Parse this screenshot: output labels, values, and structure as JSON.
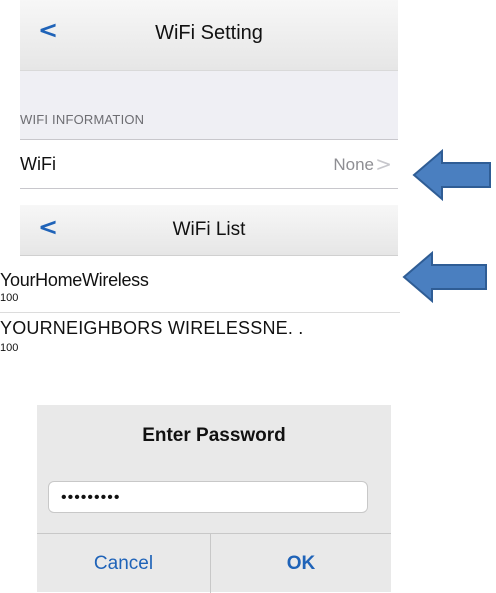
{
  "wifi_setting": {
    "back_icon": "<",
    "title": "WiFi Setting",
    "section_label": "WIFI INFORMATION",
    "row": {
      "label": "WiFi",
      "value": "None",
      "chevron": ">"
    }
  },
  "wifi_list": {
    "back_icon": "<",
    "title": "WiFi List",
    "networks": [
      {
        "name": "YourHomeWireless",
        "signal": "100"
      },
      {
        "name": "YOURNEIGHBORS WIRELESSNE. .",
        "signal": "100"
      }
    ]
  },
  "dialog": {
    "title": "Enter Password",
    "password_mask": "•••••••••",
    "cancel_label": "Cancel",
    "ok_label": "OK"
  },
  "colors": {
    "accent": "#1f63b8",
    "arrow": "#4a7fc0"
  },
  "icons": [
    "back-chevron-icon",
    "chevron-right-icon",
    "pointer-arrow-icon"
  ]
}
